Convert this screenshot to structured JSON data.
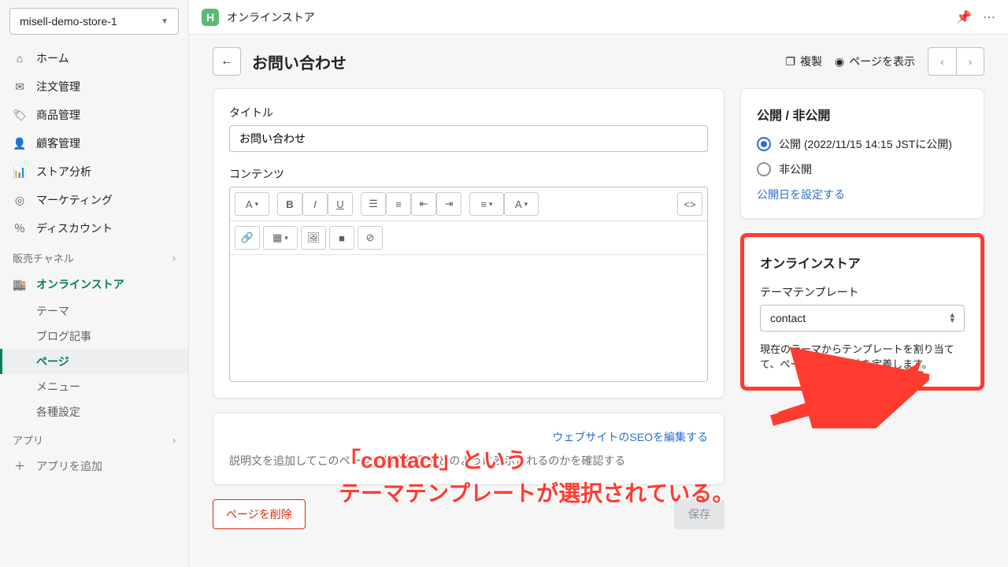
{
  "store_name": "misell-demo-store-1",
  "topbar_title": "オンラインストア",
  "nav": {
    "home": "ホーム",
    "orders": "注文管理",
    "products": "商品管理",
    "customers": "顧客管理",
    "analytics": "ストア分析",
    "marketing": "マーケティング",
    "discounts": "ディスカウント"
  },
  "sales_channel_header": "販売チャネル",
  "online_store": "オンラインストア",
  "sub": {
    "theme": "テーマ",
    "blog": "ブログ記事",
    "pages": "ページ",
    "menu": "メニュー",
    "settings": "各種設定"
  },
  "apps_header": "アプリ",
  "add_app": "アプリを追加",
  "page_title": "お問い合わせ",
  "duplicate": "複製",
  "view_page": "ページを表示",
  "title_label": "タイトル",
  "title_value": "お問い合わせ",
  "content_label": "コンテンツ",
  "rte": {
    "style": "A"
  },
  "seo": {
    "edit": "ウェブサイトのSEOを編集する",
    "desc": "説明文を追加してこのページが検索結果でどのように表示されるのかを確認する"
  },
  "visibility": {
    "title": "公開 / 非公開",
    "public": "公開 (2022/11/15 14:15 JSTに公開)",
    "private": "非公開",
    "set_date": "公開日を設定する"
  },
  "template_card": {
    "title": "オンラインストア",
    "label": "テーマテンプレート",
    "value": "contact",
    "help": "現在のテーマからテンプレートを割り当てて、ページの表示方法を定義します。"
  },
  "delete_page": "ページを削除",
  "save": "保存",
  "annotation_line1": "「contact」という",
  "annotation_line2": "テーマテンプレートが選択されている。"
}
